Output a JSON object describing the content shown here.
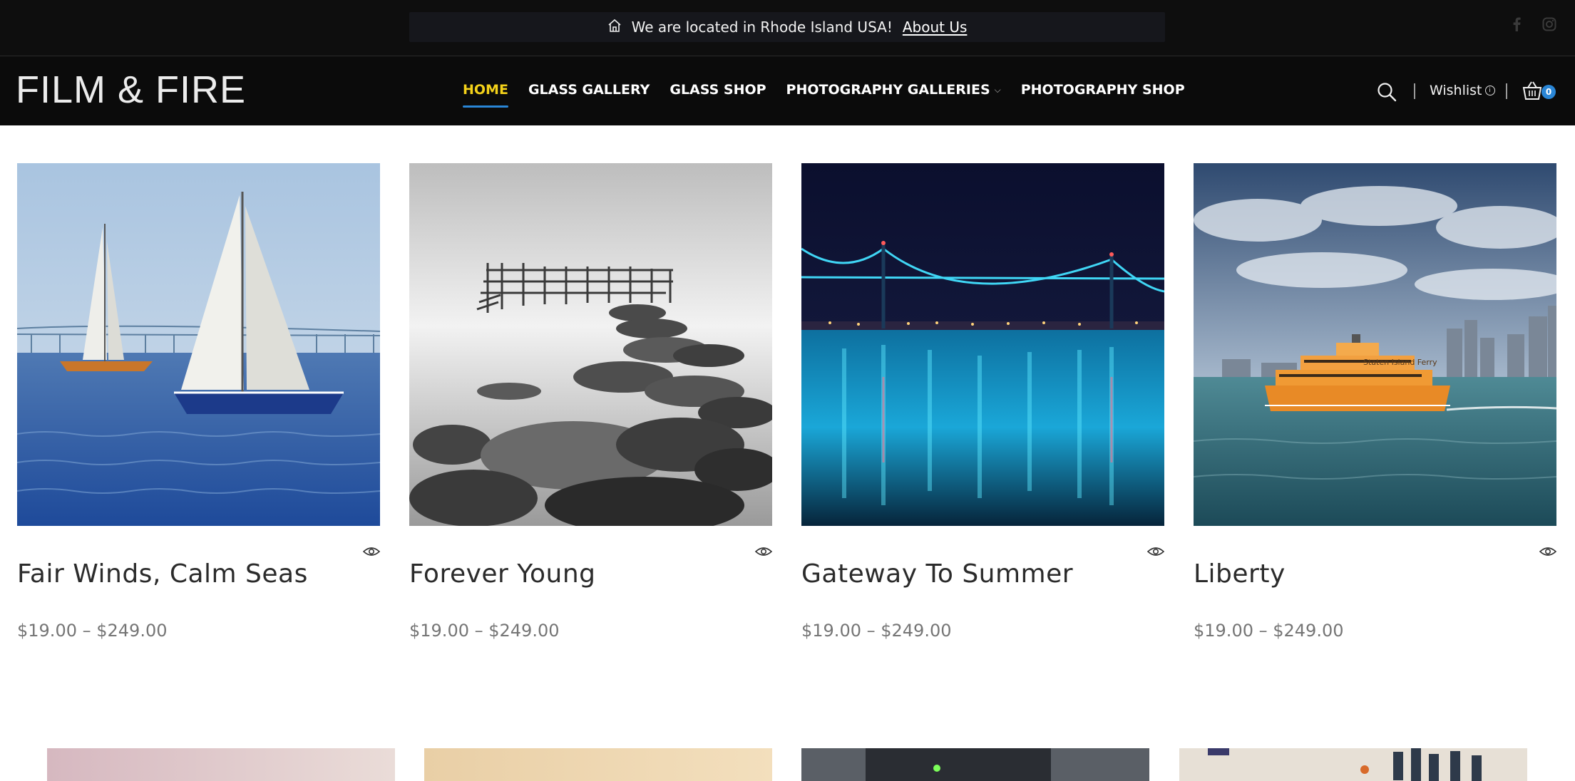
{
  "topbar": {
    "notice_text": "We are located in Rhode Island USA!",
    "about_link": "About Us",
    "social_icons": [
      "facebook-icon",
      "instagram-icon"
    ]
  },
  "header": {
    "logo": "FILM & FIRE",
    "nav": [
      {
        "label": "HOME",
        "active": true
      },
      {
        "label": "GLASS GALLERY",
        "active": false
      },
      {
        "label": "GLASS SHOP",
        "active": false
      },
      {
        "label": "PHOTOGRAPHY GALLERIES",
        "active": false,
        "has_dropdown": true
      },
      {
        "label": "PHOTOGRAPHY SHOP",
        "active": false
      }
    ],
    "wishlist_label": "Wishlist",
    "cart_count": "0"
  },
  "products": [
    {
      "title": "Fair Winds, Calm Seas",
      "price": "$19.00 – $249.00",
      "image": "sailboats-on-bay"
    },
    {
      "title": "Forever Young",
      "price": "$19.00 – $249.00",
      "image": "black-white-pier-rocks"
    },
    {
      "title": "Gateway To Summer",
      "price": "$19.00 – $249.00",
      "image": "bridge-lights-at-night"
    },
    {
      "title": "Liberty",
      "price": "$19.00 – $249.00",
      "image": "staten-island-ferry"
    }
  ],
  "colors": {
    "accent_blue": "#2a86d6",
    "active_nav": "#f4d21a",
    "header_bg": "#0b0b0b"
  }
}
